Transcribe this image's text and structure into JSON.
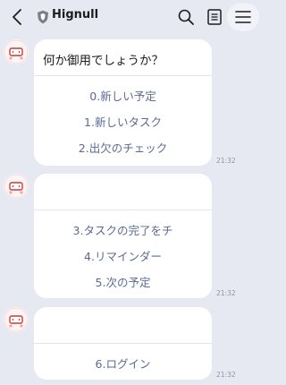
{
  "header": {
    "title": "Hignull"
  },
  "messages": [
    {
      "question": "何か御用でしょうか？",
      "options": [
        "0.新しい予定",
        "1.新しいタスク",
        "2.出欠のチェック"
      ],
      "time": "21:32"
    },
    {
      "question": "",
      "options": [
        "3.タスクの完了をチ",
        "4.リマインダー",
        "5.次の予定"
      ],
      "time": "21:32"
    },
    {
      "question": "",
      "options": [
        "6.ログイン"
      ],
      "time": "21:32"
    }
  ],
  "icons": {
    "back": "chevron-left-icon",
    "shield": "shield-icon",
    "search": "search-icon",
    "notes": "notes-icon",
    "menu": "menu-icon"
  },
  "colors": {
    "background": "#e6e9f2",
    "option_text": "#5b6a92",
    "bubble": "#ffffff"
  }
}
